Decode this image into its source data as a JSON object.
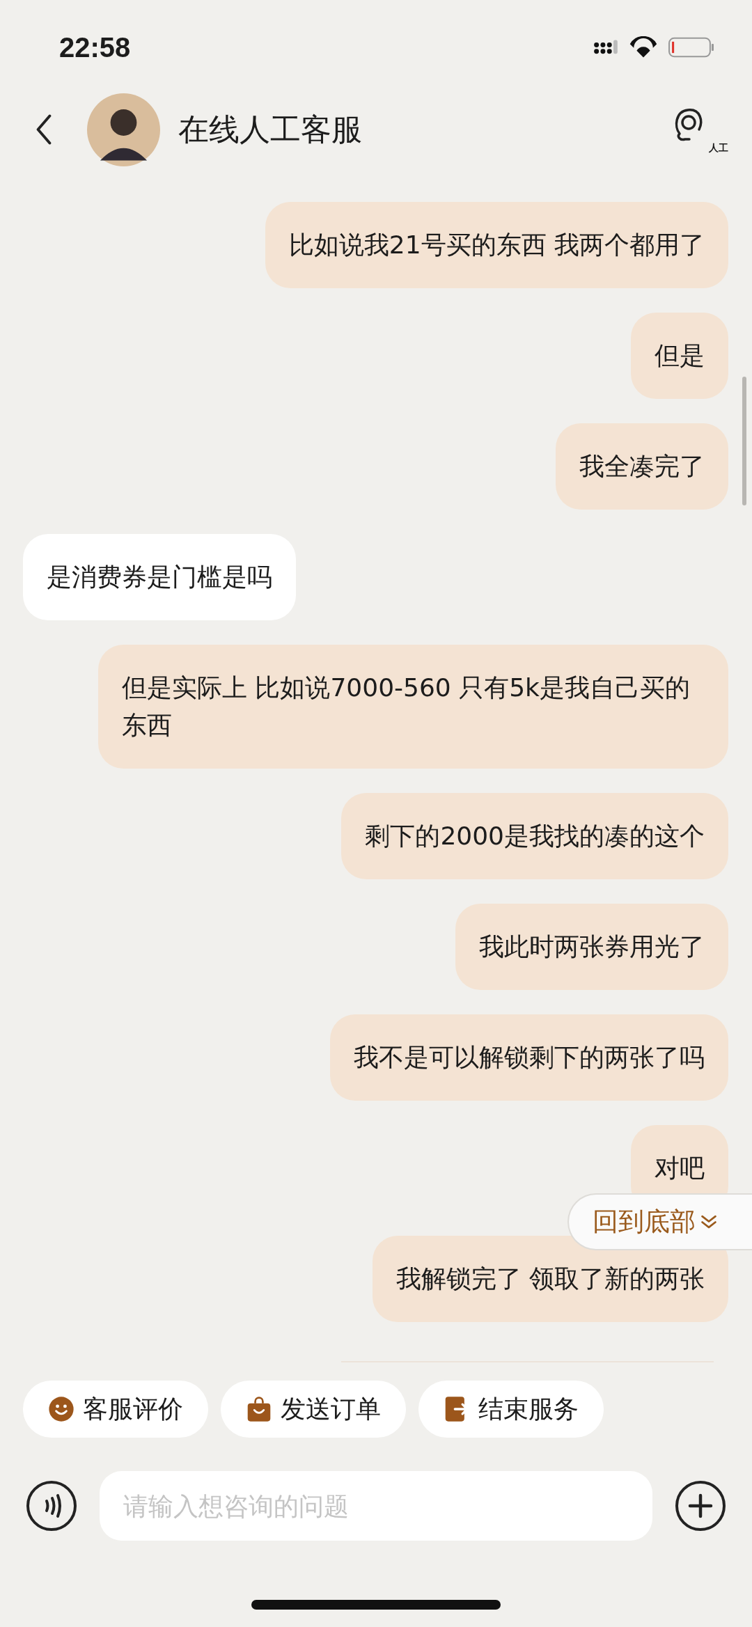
{
  "status_bar": {
    "time": "22:58"
  },
  "header": {
    "title": "在线人工客服",
    "agent_badge": "人工"
  },
  "messages": [
    {
      "kind": "sent",
      "text": "比如说我21号买的东西 我两个都用了"
    },
    {
      "kind": "sent",
      "text": "但是"
    },
    {
      "kind": "sent",
      "text": "我全凑完了"
    },
    {
      "kind": "received",
      "text": "是消费券是门槛是吗"
    },
    {
      "kind": "sent",
      "text": "但是实际上 比如说7000-560 只有5k是我自己买的东西"
    },
    {
      "kind": "sent",
      "text": "剩下的2000是我找的凑的这个"
    },
    {
      "kind": "sent",
      "text": "我此时两张券用光了"
    },
    {
      "kind": "sent",
      "text": "我不是可以解锁剩下的两张了吗"
    },
    {
      "kind": "sent",
      "text": "对吧"
    },
    {
      "kind": "sent",
      "text": "我解锁完了 领取了新的两张"
    }
  ],
  "jump_button": {
    "label": "回到底部"
  },
  "quick_actions": [
    {
      "kind": "smile",
      "label": "客服评价"
    },
    {
      "kind": "bag",
      "label": "发送订单"
    },
    {
      "kind": "exit",
      "label": "结束服务"
    }
  ],
  "input": {
    "placeholder": "请输入想咨询的问题"
  }
}
